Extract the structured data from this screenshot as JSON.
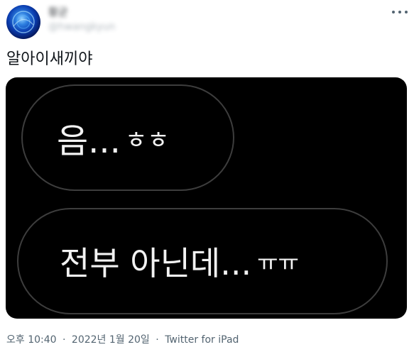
{
  "author": {
    "display_name": "황균",
    "handle": "@hwangkyun"
  },
  "tweet": {
    "text": "알아이새끼야"
  },
  "media": {
    "bubble1": {
      "main": "음...",
      "small": "ㅎㅎ"
    },
    "bubble2": {
      "main": "전부 아닌데...",
      "small": "ㅠㅠ"
    }
  },
  "meta": {
    "time": "오후 10:40",
    "separator": "·",
    "date": "2022년 1월 20일",
    "source": "Twitter for iPad"
  },
  "icons": {
    "more": "more-dots-icon"
  }
}
